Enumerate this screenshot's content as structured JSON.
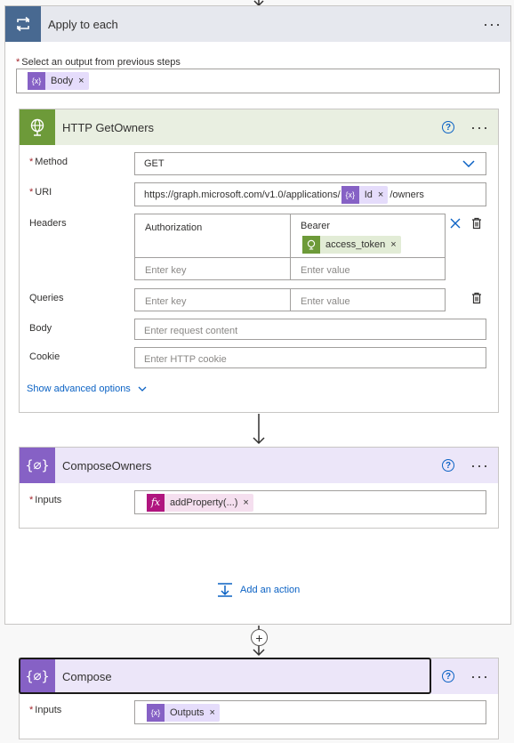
{
  "apply_each": {
    "title": "Apply to each",
    "select_label": "Select an output from previous steps",
    "token": "Body"
  },
  "http": {
    "title": "HTTP GetOwners",
    "method_label": "Method",
    "method_value": "GET",
    "uri_label": "URI",
    "uri_prefix": "https://graph.microsoft.com/v1.0/applications/",
    "uri_token": "Id",
    "uri_suffix": "/owners",
    "headers_label": "Headers",
    "header_key": "Authorization",
    "header_value_text": "Bearer",
    "header_value_token": "access_token",
    "enter_key": "Enter key",
    "enter_value": "Enter value",
    "queries_label": "Queries",
    "body_label": "Body",
    "body_placeholder": "Enter request content",
    "cookie_label": "Cookie",
    "cookie_placeholder": "Enter HTTP cookie",
    "advanced_link": "Show advanced options"
  },
  "compose_owners": {
    "title": "ComposeOwners",
    "inputs_label": "Inputs",
    "token": "addProperty(...)"
  },
  "add_action": "Add an action",
  "compose": {
    "title": "Compose",
    "inputs_label": "Inputs",
    "token": "Outputs"
  },
  "colors": {
    "apply_header": "#e6e8ee",
    "loop_icon": "#486991",
    "http_header": "#e9efe1",
    "http_icon": "#6d9a39",
    "compose_header": "#ece6f9",
    "compose_icon": "#8661c5",
    "link": "#0b62c4"
  },
  "icons": {
    "loop": "loop-icon",
    "http": "globe-icon",
    "compose": "curly-braces-icon",
    "help": "question-icon",
    "more": "ellipsis-icon",
    "delete": "close-icon",
    "trash": "trash-icon",
    "chevron": "chevron-down-icon",
    "add_action": "add-action-icon",
    "plus": "plus-icon",
    "arrow": "arrow-down-icon"
  }
}
